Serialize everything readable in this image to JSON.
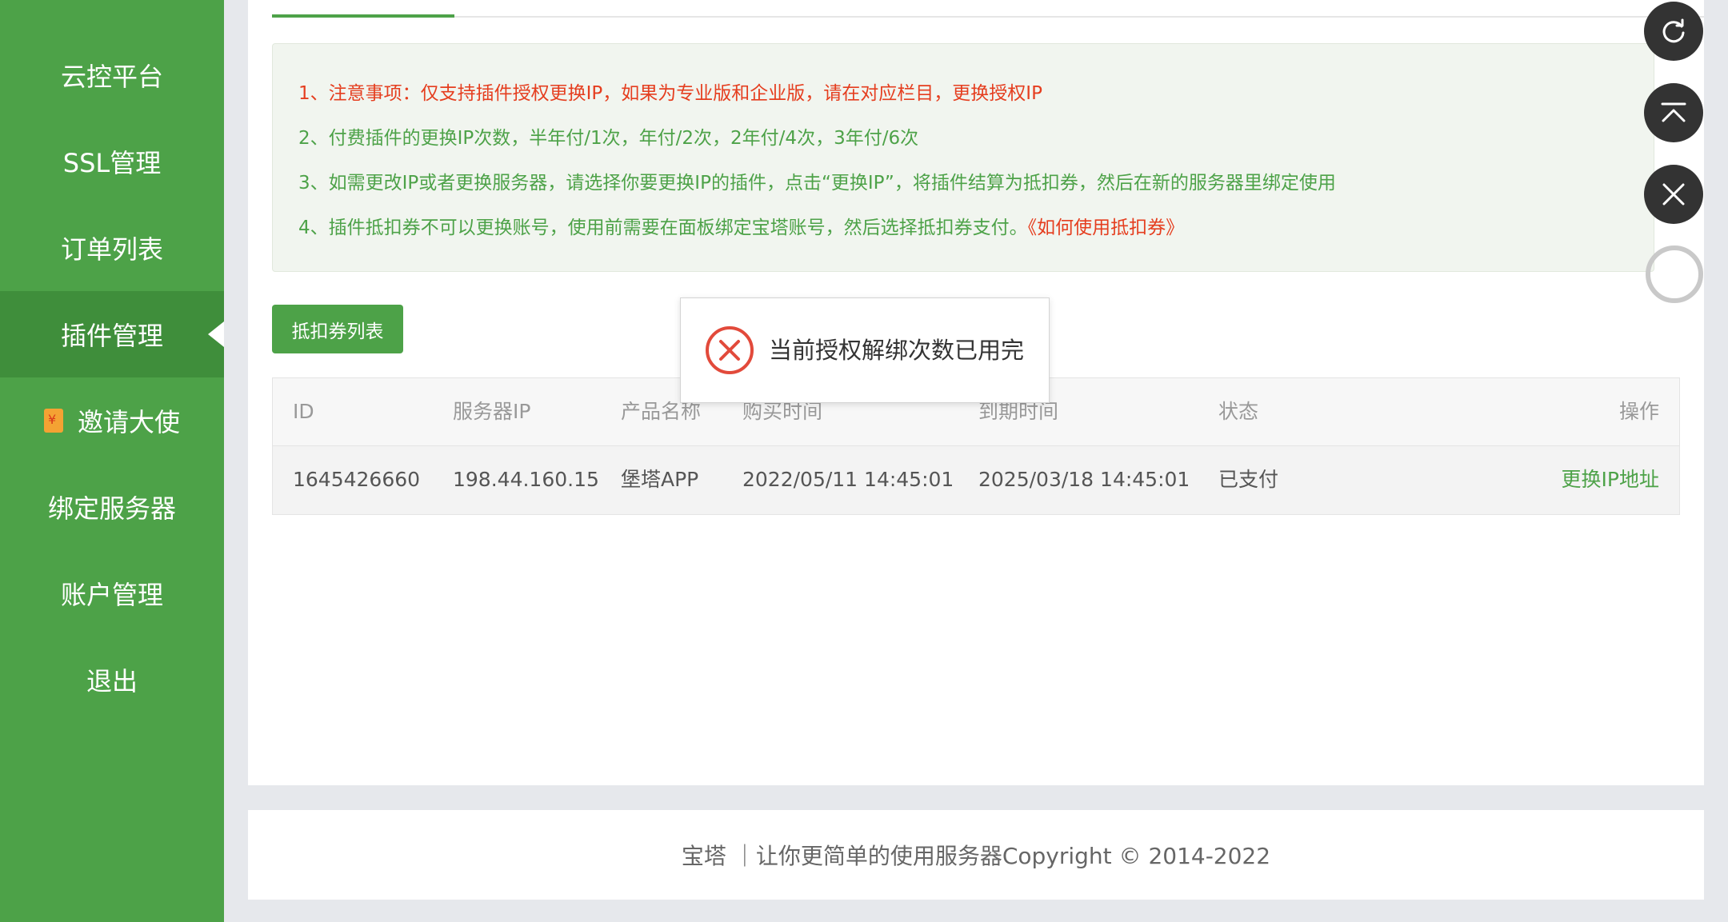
{
  "sidebar": {
    "items": [
      {
        "label": "云控平台"
      },
      {
        "label": "SSL管理"
      },
      {
        "label": "订单列表"
      },
      {
        "label": "插件管理",
        "active": true
      },
      {
        "label": "邀请大使",
        "icon": "red-envelope-icon"
      },
      {
        "label": "绑定服务器"
      },
      {
        "label": "账户管理"
      },
      {
        "label": "退出"
      }
    ]
  },
  "notice": {
    "line1": "1、注意事项：仅支持插件授权更换IP，如果为专业版和企业版，请在对应栏目，更换授权IP",
    "line2": "2、付费插件的更换IP次数，半年付/1次，年付/2次，2年付/4次，3年付/6次",
    "line3": "3、如需更改IP或者更换服务器，请选择你要更换IP的插件，点击“更换IP”，将插件结算为抵扣券，然后在新的服务器里绑定使用",
    "line4": "4、插件抵扣券不可以更换账号，使用前需要在面板绑定宝塔账号，然后选择抵扣券支付。",
    "line4_link": "《如何使用抵扣券》"
  },
  "coupon_button": "抵扣券列表",
  "table": {
    "headers": [
      "ID",
      "服务器IP",
      "产品名称",
      "购买时间",
      "到期时间",
      "状态",
      "操作"
    ],
    "rows": [
      {
        "id": "1645426660",
        "ip": "198.44.160.15",
        "product": "堡塔APP",
        "buy_time": "2022/05/11 14:45:01",
        "expire_time": "2025/03/18 14:45:01",
        "status": "已支付",
        "action": "更换IP地址"
      }
    ]
  },
  "toast": {
    "message": "当前授权解绑次数已用完",
    "icon": "error-circle-icon"
  },
  "footer": {
    "text": "宝塔 ｜让你更简单的使用服务器Copyright © 2014-2022"
  },
  "floating": [
    "refresh-icon",
    "back-to-top-icon",
    "close-icon",
    "loading-ring"
  ],
  "colors": {
    "brand_green": "#4da248",
    "active_green": "#3f8e3b",
    "warning_red": "#e53e1f"
  }
}
